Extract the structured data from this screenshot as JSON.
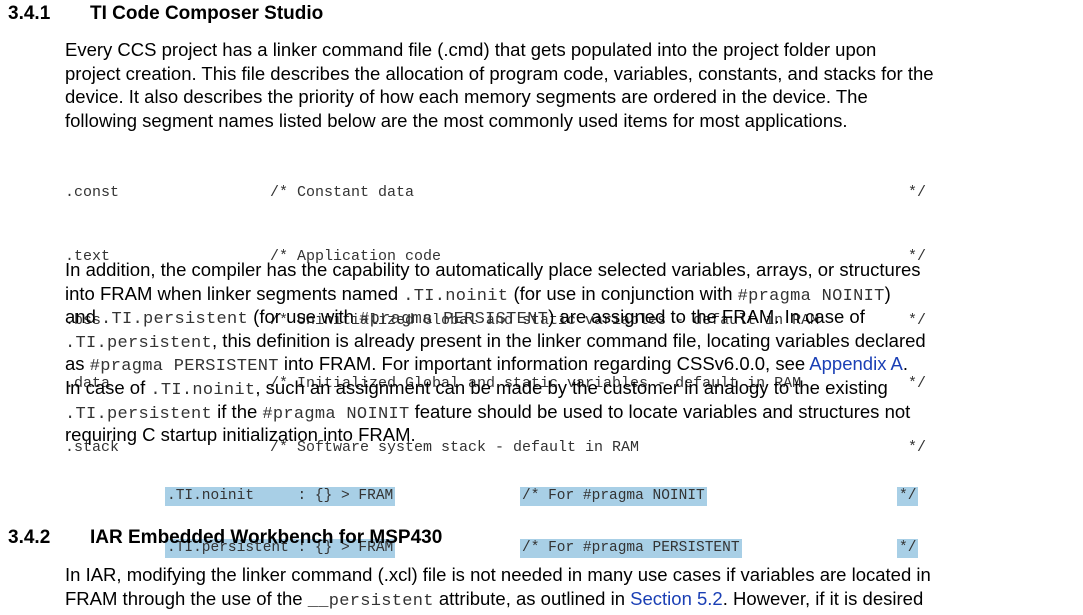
{
  "section_341": {
    "number": "3.4.1",
    "title": "TI Code Composer Studio"
  },
  "para1": [
    "Every CCS project has a linker command file (.cmd) that gets populated into the project folder upon",
    "project creation. This file describes the allocation of program code, variables, constants, and stacks for the",
    "device. It also describes the priority of how each memory segments are ordered in the device. The",
    "following segment names listed below are the most commonly used items for most applications."
  ],
  "segments": [
    {
      "name": ".const",
      "comment": "/* Constant data",
      "end": "*/"
    },
    {
      "name": ".text",
      "comment": "/* Application code",
      "end": "*/"
    },
    {
      "name": ".bss",
      "comment": "/* Uninitialized Global and static variables - default in RAM",
      "end": "*/"
    },
    {
      "name": ".data",
      "comment": "/* Initialized Global and static variables - default in RAM",
      "end": "*/"
    },
    {
      "name": ".stack",
      "comment": "/* Software system stack - default in RAM",
      "end": "*/"
    }
  ],
  "para2": {
    "l1": "In addition, the compiler has the capability to automatically place selected variables, arrays, or structures",
    "l2a": "into FRAM when linker segments named ",
    "l2b": ".TI.noinit",
    "l2c": " (for use in conjunction with ",
    "l2d": "#pragma NOINIT",
    "l2e": ")",
    "l3a": "and ",
    "l3b": ".TI.persistent",
    "l3c": " (for use with ",
    "l3d": "#pragma PERSISTENT",
    "l3e": ") are assigned to the FRAM. In case of",
    "l4a": ".TI.persistent",
    "l4b": ", this definition is already present in the linker command file, locating variables declared",
    "l5a": "as ",
    "l5b": "#pragma PERSISTENT",
    "l5c": " into FRAM. For important information regarding CSSv6.0.0, see ",
    "l5d": "Appendix A",
    "l5e": ".",
    "l6a": "In case of ",
    "l6b": ".TI.noinit",
    "l6c": ", such an assignment can be made by the customer in analogy to the existing",
    "l7a": ".TI.persistent",
    "l7b": " if the ",
    "l7c": "#pragma NOINIT",
    "l7d": " feature should be used to locate variables and structures not",
    "l8": "requiring C startup initialization into FRAM."
  },
  "highlighted": [
    {
      "decl": ".TI.noinit     : {} > FRAM",
      "comment": "/* For #pragma NOINIT",
      "end": "*/"
    },
    {
      "decl": ".TI.persistent : {} > FRAM",
      "comment": "/* For #pragma PERSISTENT",
      "end": "*/"
    }
  ],
  "section_342": {
    "number": "3.4.2",
    "title": "IAR Embedded Workbench for MSP430"
  },
  "para3": {
    "l1": "In IAR, modifying the linker command (.xcl) file is not needed in many use cases if variables are located in",
    "l2a": "FRAM through the use of the ",
    "l2b": "__persistent",
    "l2c": " attribute, as outlined in ",
    "l2d": "Section 5.2",
    "l2e": ". However, if it is desired"
  }
}
